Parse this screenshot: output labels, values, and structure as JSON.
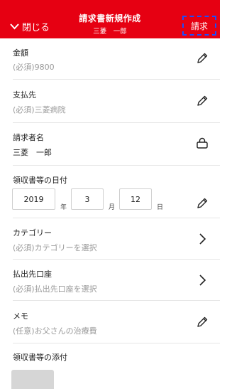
{
  "header": {
    "close_label": "閉じる",
    "title": "請求書新規作成",
    "subtitle": "三菱　一郎",
    "submit_label": "請求",
    "bg_color": "#e60012"
  },
  "fields": [
    {
      "label": "金額",
      "value": "(必須)9800",
      "icon": "pencil-icon"
    },
    {
      "label": "支払先",
      "value": "(必須)三菱病院",
      "icon": "pencil-icon"
    },
    {
      "label": "請求者名",
      "value": "三菱　一郎",
      "icon": "lock-icon"
    }
  ],
  "receipt_date": {
    "label": "領収書等の日付",
    "year": "2019",
    "year_unit": "年",
    "month": "3",
    "month_unit": "月",
    "day": "12",
    "day_unit": "日",
    "icon": "pencil-icon"
  },
  "selects": [
    {
      "label": "カテゴリー",
      "value": "(必須)カテゴリーを選択",
      "icon": "chevron-right-icon"
    },
    {
      "label": "払出先口座",
      "value": "(必須)払出先口座を選択",
      "icon": "chevron-right-icon"
    }
  ],
  "memo": {
    "label": "メモ",
    "value": "(任意)お父さんの治療費",
    "icon": "pencil-icon"
  },
  "attachment": {
    "label": "領収書等の添付"
  }
}
